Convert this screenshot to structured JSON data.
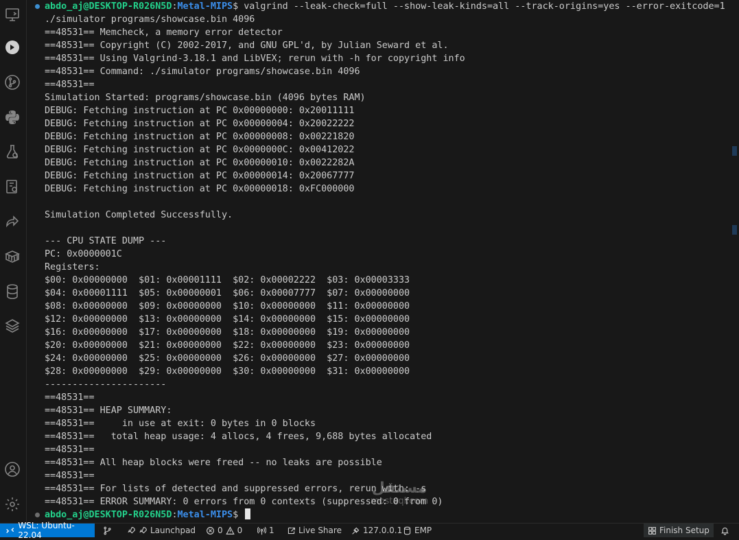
{
  "activity_bar": {
    "icons": [
      "remote-explorer-icon",
      "run-debug-icon",
      "source-control-icon",
      "python-icon",
      "test-icon",
      "extensions-remote-icon",
      "live-share-icon",
      "containers-icon",
      "database-icon",
      "stack-icon",
      "account-icon",
      "settings-gear-icon"
    ]
  },
  "terminal": {
    "prompt_user": "abdo_aj@DESKTOP-R026N5D",
    "prompt_colon": ":",
    "prompt_path": "Metal-MIPS",
    "prompt_dollar": "$ ",
    "command": "valgrind --leak-check=full --show-leak-kinds=all --track-origins=yes --error-exitcode=1",
    "lines": [
      "./simulator programs/showcase.bin 4096",
      "==48531== Memcheck, a memory error detector",
      "==48531== Copyright (C) 2002-2017, and GNU GPL'd, by Julian Seward et al.",
      "==48531== Using Valgrind-3.18.1 and LibVEX; rerun with -h for copyright info",
      "==48531== Command: ./simulator programs/showcase.bin 4096",
      "==48531==",
      "Simulation Started: programs/showcase.bin (4096 bytes RAM)",
      "DEBUG: Fetching instruction at PC 0x00000000: 0x20011111",
      "DEBUG: Fetching instruction at PC 0x00000004: 0x20022222",
      "DEBUG: Fetching instruction at PC 0x00000008: 0x00221820",
      "DEBUG: Fetching instruction at PC 0x0000000C: 0x00412022",
      "DEBUG: Fetching instruction at PC 0x00000010: 0x0022282A",
      "DEBUG: Fetching instruction at PC 0x00000014: 0x20067777",
      "DEBUG: Fetching instruction at PC 0x00000018: 0xFC000000",
      "",
      "Simulation Completed Successfully.",
      "",
      "--- CPU STATE DUMP ---",
      "PC: 0x0000001C",
      "Registers:",
      "$00: 0x00000000  $01: 0x00001111  $02: 0x00002222  $03: 0x00003333",
      "$04: 0x00001111  $05: 0x00000001  $06: 0x00007777  $07: 0x00000000",
      "$08: 0x00000000  $09: 0x00000000  $10: 0x00000000  $11: 0x00000000",
      "$12: 0x00000000  $13: 0x00000000  $14: 0x00000000  $15: 0x00000000",
      "$16: 0x00000000  $17: 0x00000000  $18: 0x00000000  $19: 0x00000000",
      "$20: 0x00000000  $21: 0x00000000  $22: 0x00000000  $23: 0x00000000",
      "$24: 0x00000000  $25: 0x00000000  $26: 0x00000000  $27: 0x00000000",
      "$28: 0x00000000  $29: 0x00000000  $30: 0x00000000  $31: 0x00000000",
      "----------------------",
      "==48531==",
      "==48531== HEAP SUMMARY:",
      "==48531==     in use at exit: 0 bytes in 0 blocks",
      "==48531==   total heap usage: 4 allocs, 4 frees, 9,688 bytes allocated",
      "==48531==",
      "==48531== All heap blocks were freed -- no leaks are possible",
      "==48531==",
      "==48531== For lists of detected and suppressed errors, rerun with: -s",
      "==48531== ERROR SUMMARY: 0 errors from 0 contexts (suppressed: 0 from 0)"
    ]
  },
  "watermark": {
    "arabic": "مستقل",
    "latin": "mostaql.com"
  },
  "statusbar": {
    "remote": "WSL: Ubuntu-22.04",
    "launchpad": "Launchpad",
    "errors": "0",
    "warnings": "0",
    "ports": "1",
    "live_share": "Live Share",
    "host": "127.0.0.1",
    "emp": "EMP",
    "finish_setup": "Finish Setup"
  }
}
